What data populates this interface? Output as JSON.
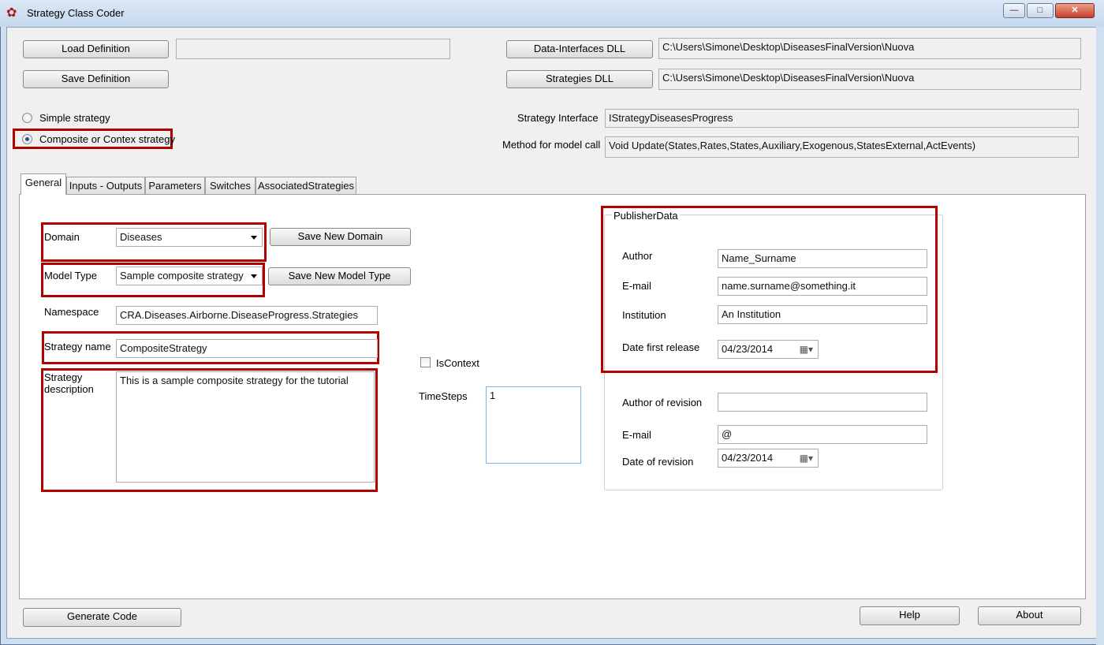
{
  "window": {
    "title": "Strategy Class Coder",
    "controls": {
      "minimize": "—",
      "maximize": "□",
      "close": "✕"
    }
  },
  "top": {
    "load_definition": "Load Definition",
    "load_path": "",
    "save_definition": "Save Definition",
    "data_interfaces_dll": "Data-Interfaces DLL",
    "data_interfaces_path": "C:\\Users\\Simone\\Desktop\\DiseasesFinalVersion\\Nuova",
    "strategies_dll": "Strategies DLL",
    "strategies_path": "C:\\Users\\Simone\\Desktop\\DiseasesFinalVersion\\Nuova",
    "radio_simple": "Simple strategy",
    "radio_composite": "Composite or Contex strategy",
    "strategy_interface_label": "Strategy Interface",
    "strategy_interface_value": "IStrategyDiseasesProgress",
    "method_label": "Method for model call",
    "method_value": "Void Update(States,Rates,States,Auxiliary,Exogenous,StatesExternal,ActEvents)"
  },
  "tabs": [
    "General",
    "Inputs - Outputs",
    "Parameters",
    "Switches",
    "AssociatedStrategies"
  ],
  "general": {
    "domain_label": "Domain",
    "domain_value": "Diseases",
    "save_new_domain": "Save New Domain",
    "model_type_label": "Model Type",
    "model_type_value": "Sample composite strategy",
    "save_new_model_type": "Save New Model Type",
    "namespace_label": "Namespace",
    "namespace_value": "CRA.Diseases.Airborne.DiseaseProgress.Strategies",
    "strategy_name_label": "Strategy name",
    "strategy_name_value": "CompositeStrategy",
    "strategy_description_label": "Strategy description",
    "strategy_description_value": "This is a sample composite strategy for the tutorial",
    "is_context_label": "IsContext",
    "timesteps_label": "TimeSteps",
    "timesteps_value": "1"
  },
  "publisher": {
    "legend": "PublisherData",
    "author_label": "Author",
    "author_value": "Name_Surname",
    "email_label": "E-mail",
    "email_value": "name.surname@something.it",
    "institution_label": "Institution",
    "institution_value": "An Institution",
    "date_first_label": "Date first release",
    "date_first_value": "04/23/2014",
    "author_revision_label": "Author of revision",
    "author_revision_value": "",
    "email2_label": "E-mail",
    "email2_value": "@",
    "date_revision_label": "Date of revision",
    "date_revision_value": "04/23/2014"
  },
  "bottom": {
    "generate_code": "Generate Code",
    "help": "Help",
    "about": "About"
  },
  "colors": {
    "highlight": "#b00000",
    "window_frame": "#cfdff0",
    "close_button": "#c7402a"
  },
  "icons": {
    "app": "app-logo-icon",
    "calendar": "calendar-icon",
    "dropdown": "chevron-down-icon"
  }
}
